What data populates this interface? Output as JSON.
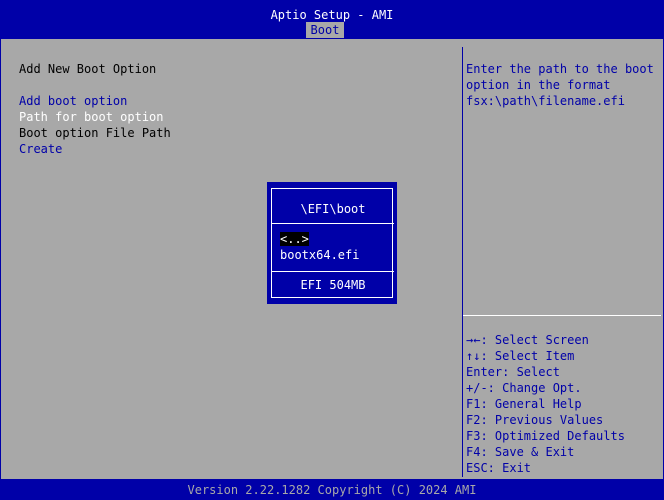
{
  "header": {
    "title": "Aptio Setup - AMI",
    "active_tab": "Boot"
  },
  "left": {
    "heading": "Add New Boot Option",
    "items": [
      {
        "label": "Add boot option",
        "color": "#0000a8"
      },
      {
        "label": "Path for boot option",
        "color": "#ffffff"
      },
      {
        "label": "Boot option File Path",
        "color": "#000000"
      },
      {
        "label": "Create",
        "color": "#0000a8"
      }
    ]
  },
  "help": {
    "text": "Enter the path to the boot option in the format fsx:\\path\\filename.efi"
  },
  "keys": [
    "→←: Select Screen",
    "↑↓: Select Item",
    "Enter: Select",
    "+/-: Change Opt.",
    "F1: General Help",
    "F2: Previous Values",
    "F3: Optimized Defaults",
    "F4: Save & Exit",
    "ESC: Exit"
  ],
  "dialog": {
    "title": "\\EFI\\boot",
    "entries": [
      "<..>",
      "bootx64.efi"
    ],
    "selected_index": 0,
    "footer": "EFI 504MB"
  },
  "footer": {
    "version": "Version 2.22.1282 Copyright (C) 2024 AMI"
  },
  "colors": {
    "bios_blue": "#0000a8",
    "bios_gray": "#a8a8a8",
    "highlight_white": "#ffffff"
  }
}
